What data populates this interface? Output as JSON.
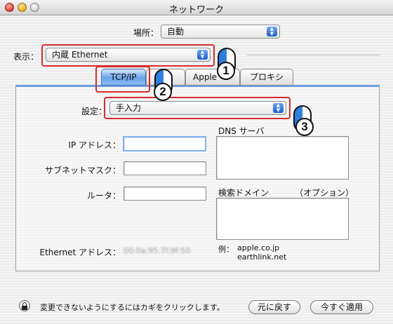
{
  "window": {
    "title": "ネットワーク"
  },
  "location": {
    "label": "場所：",
    "value": "自動"
  },
  "show": {
    "label": "表示：",
    "value": "内蔵 Ethernet"
  },
  "tabs": [
    {
      "label": "TCP/IP"
    },
    {
      "label": ""
    },
    {
      "label": "Apple"
    },
    {
      "label": "プロキシ"
    }
  ],
  "tcpip": {
    "config_label": "設定：",
    "config_value": "手入力",
    "ip_label": "IP アドレス：",
    "subnet_label": "サブネットマスク：",
    "router_label": "ルータ：",
    "dns_label": "DNS サーバ",
    "search_domain_label": "検索ドメイン",
    "optional_label": "（オプション）",
    "ethernet_label": "Ethernet アドレス：",
    "ethernet_value": "00:0a:95:7f:9f:50",
    "example_label": "例：",
    "example_line1": "apple.co.jp",
    "example_line2": "earthlink.net"
  },
  "footer": {
    "lock_text": "変更できないようにするにはカギをクリックします。",
    "revert_label": "元に戻す",
    "apply_label": "今すぐ適用"
  },
  "callouts": [
    {
      "number": "1"
    },
    {
      "number": "2"
    },
    {
      "number": "3"
    }
  ],
  "colors": {
    "highlight_red": "#d92b2b",
    "accent_blue": "#2d7fdd"
  }
}
